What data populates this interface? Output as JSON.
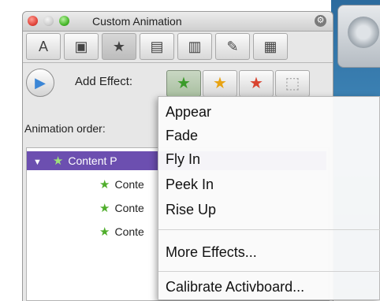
{
  "window": {
    "title": "Custom Animation"
  },
  "toolbar": {
    "icons": [
      "format-text-icon",
      "insert-media-icon",
      "custom-animation-icon",
      "slide-layout-icon",
      "library-icon",
      "tools-icon",
      "reference-icon"
    ]
  },
  "effects": {
    "add_label": "Add Effect:",
    "buttons": [
      "entrance-effect-icon",
      "emphasis-effect-icon",
      "exit-effect-icon",
      "motion-path-icon"
    ]
  },
  "order": {
    "label": "Animation order:",
    "items": [
      {
        "text": "Content P",
        "selected": true
      },
      {
        "text": "Conte",
        "selected": false
      },
      {
        "text": "Conte",
        "selected": false
      },
      {
        "text": "Conte",
        "selected": false
      }
    ]
  },
  "menu": {
    "items": [
      "Appear",
      "Fade",
      "Fly In",
      "Peek In",
      "Rise Up"
    ],
    "more": "More Effects...",
    "calibrate": "Calibrate Activboard..."
  }
}
